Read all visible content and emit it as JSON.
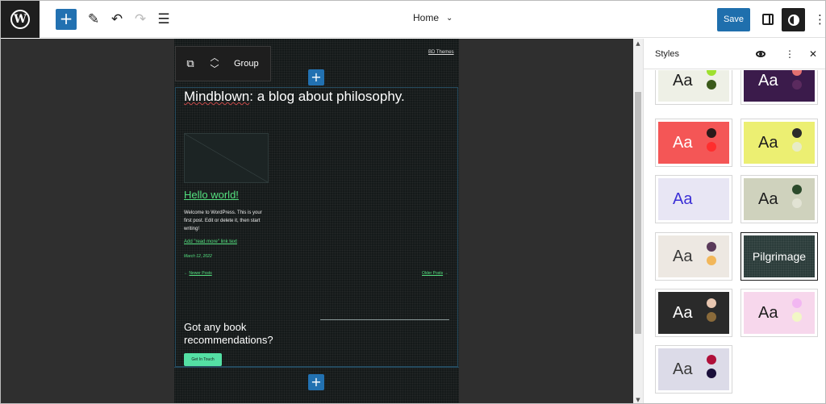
{
  "toolbar": {
    "title": "Home",
    "save_label": "Save"
  },
  "block_toolbar": {
    "label": "Group"
  },
  "preview": {
    "credit": "BD Themes",
    "site_title_part1": "Mindblown",
    "site_title_part2": ": a blog about philosophy.",
    "post_title": "Hello world!",
    "excerpt": "Welcome to WordPress. This is your first post. Edit or delete it, then start writing!",
    "read_more": "Add \"read more\" link text",
    "date": "March 12, 2022",
    "nav_newer_arrow": "←",
    "nav_newer": "Newer Posts",
    "nav_older": "Older Posts",
    "nav_older_arrow": "→",
    "cta_heading": "Got any book recommendations?",
    "cta_button": "Get In Touch"
  },
  "sidebar": {
    "title": "Styles",
    "variations": [
      {
        "label": "Aa",
        "bg": "#eef0e6",
        "text": "#1e1e1e",
        "dot1": "#9ee02f",
        "dot2": "#3a5a1a"
      },
      {
        "label": "Aa",
        "bg": "#3b1b4b",
        "text": "#ffffff",
        "dot1": "#e37070",
        "dot2": "#5a2a5e"
      },
      {
        "label": "Aa",
        "bg": "#f45656",
        "text": "#ffffff",
        "dot1": "#2b1a1a",
        "dot2": "#ff2e2e"
      },
      {
        "label": "Aa",
        "bg": "#ecef72",
        "text": "#1e1e1e",
        "dot1": "#2b2b2b",
        "dot2": "#e8ecc6"
      },
      {
        "label": "Aa",
        "bg": "#e8e6f4",
        "text": "#3b2fd6",
        "dot1": "#e8e6f4",
        "dot2": "#e8e6f4"
      },
      {
        "label": "Aa",
        "bg": "#cfd2bd",
        "text": "#1e1e1e",
        "dot1": "#2b4a2b",
        "dot2": "#e2e3d4"
      },
      {
        "label": "Aa",
        "bg": "#ede8e2",
        "text": "#3a3a3a",
        "dot1": "#5a3a5a",
        "dot2": "#f2b75a"
      },
      {
        "label": "Pilgrimage",
        "bg": "#2c3d3b",
        "text": "#ffffff"
      },
      {
        "label": "Aa",
        "bg": "#2a2a2a",
        "text": "#ffffff",
        "dot1": "#e8c6b0",
        "dot2": "#8a6a3a"
      },
      {
        "label": "Aa",
        "bg": "#f7d7ec",
        "text": "#1e1e1e",
        "dot1": "#f2b7f2",
        "dot2": "#f2f7c6"
      },
      {
        "label": "Aa",
        "bg": "#dcdbe8",
        "text": "#3a3a3a",
        "dot1": "#b0103a",
        "dot2": "#1a0f3a"
      }
    ]
  }
}
